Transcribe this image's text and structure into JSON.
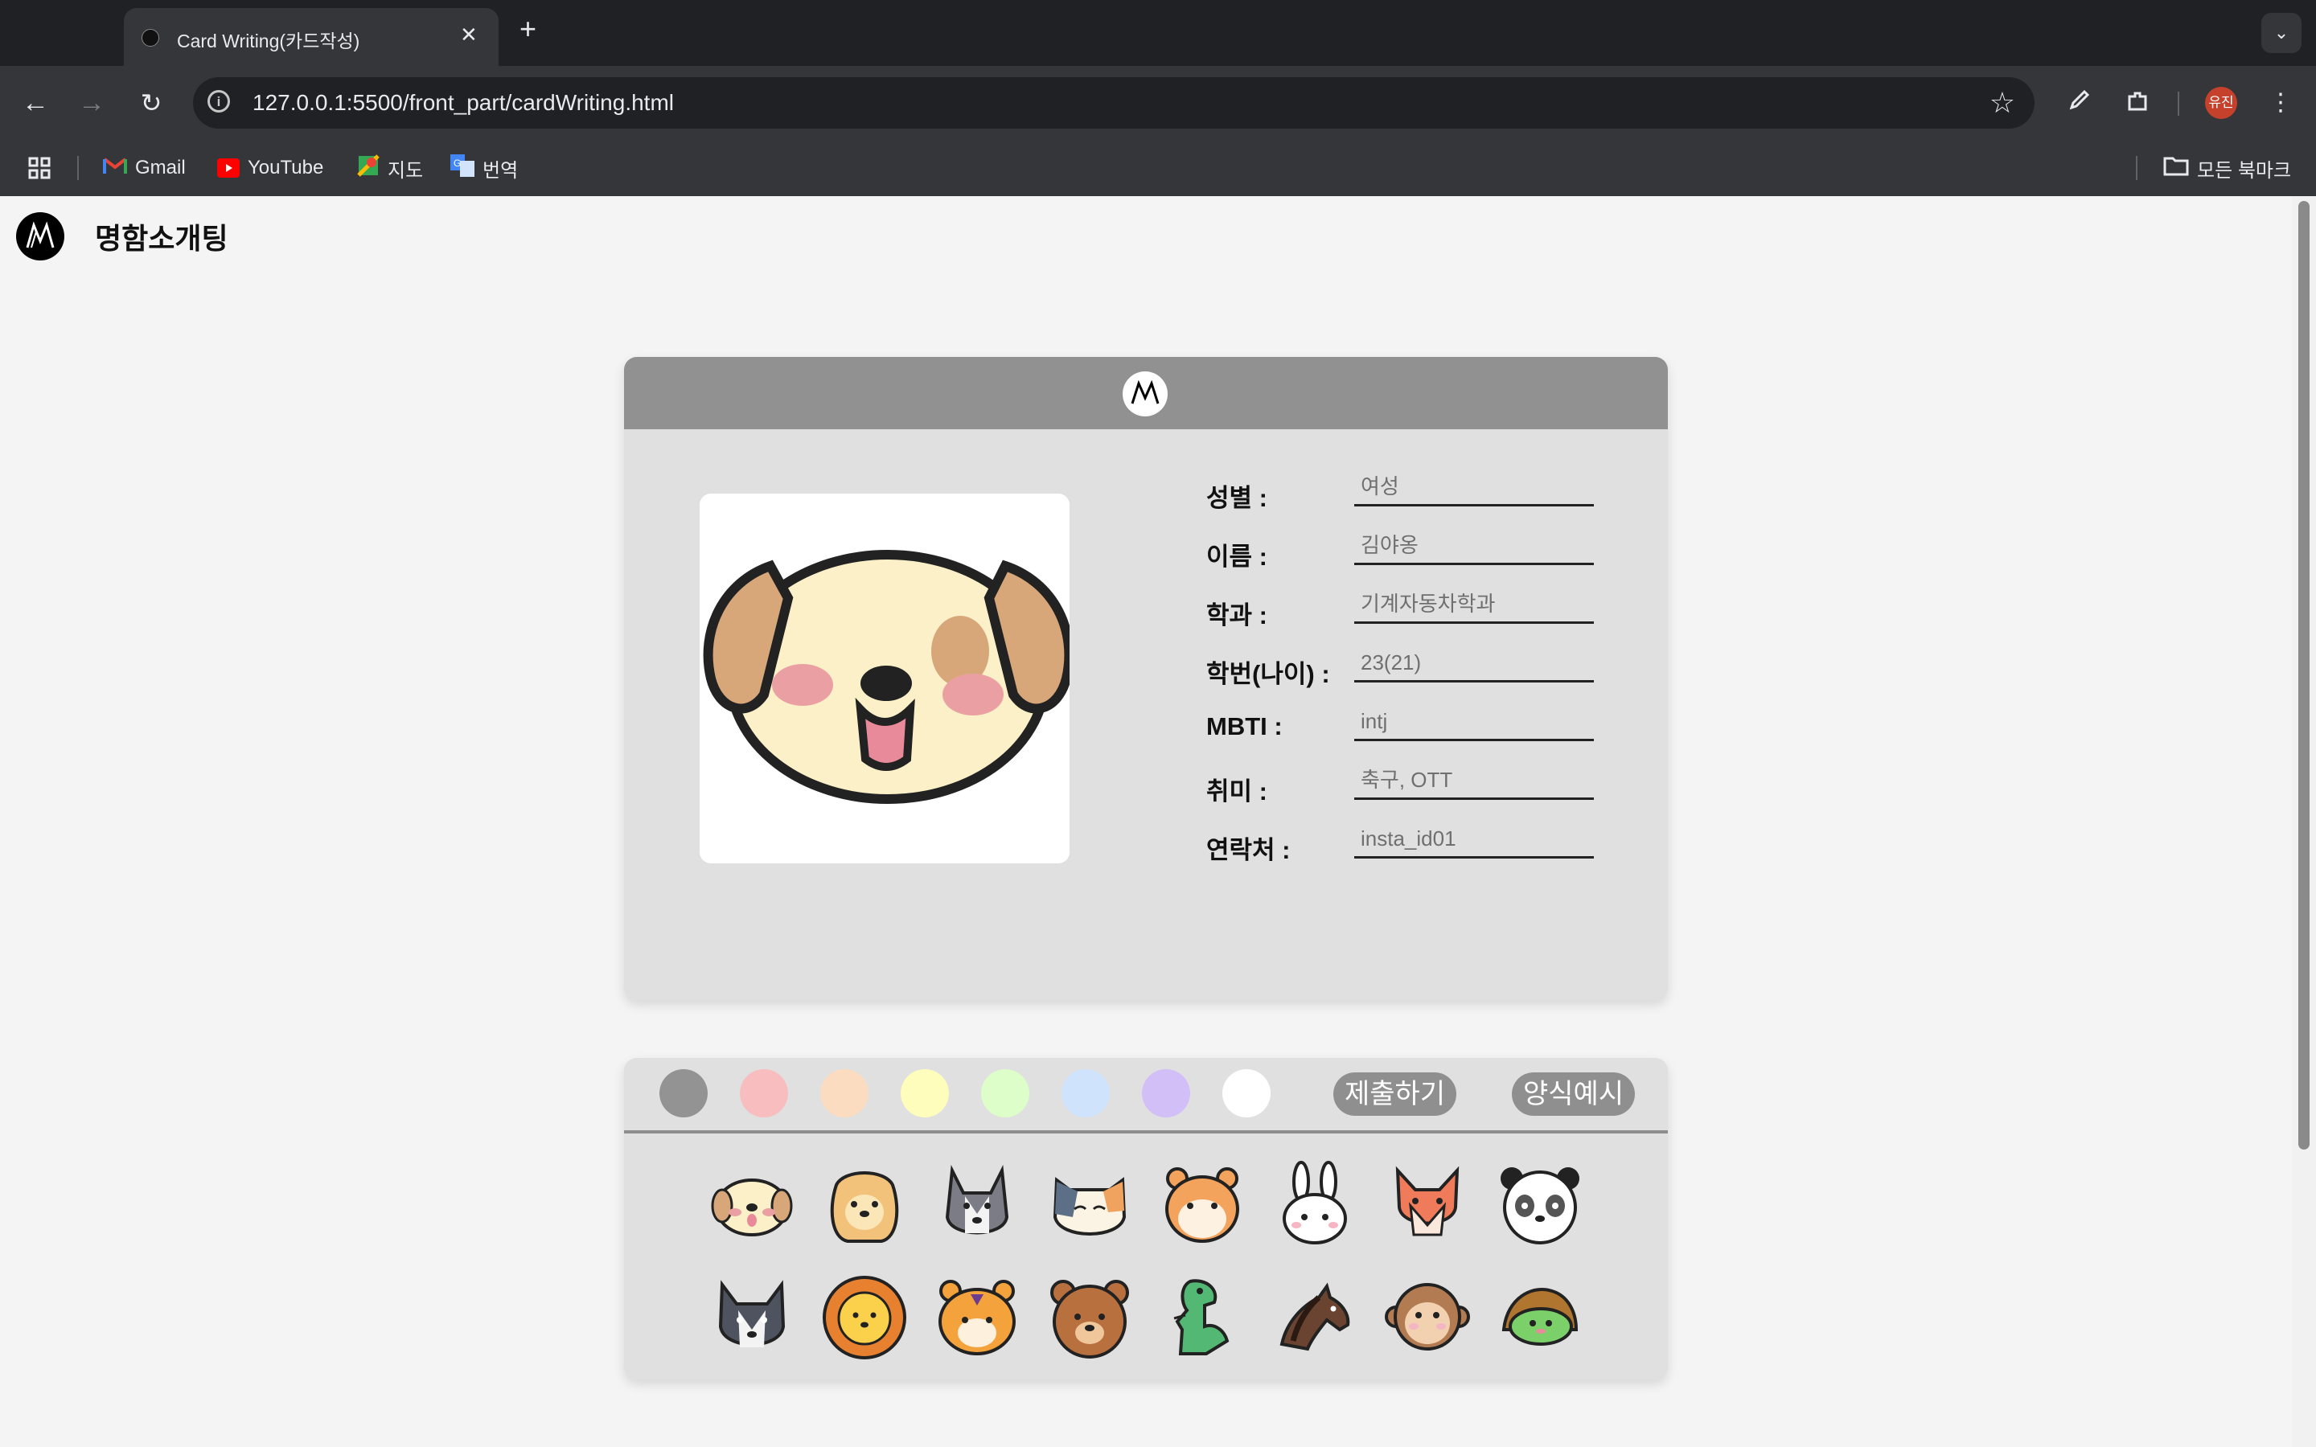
{
  "browser": {
    "tab_title": "Card Writing(카드작성)",
    "tab_close": "✕",
    "new_tab": "+",
    "url": "127.0.0.1:5500/front_part/cardWriting.html",
    "profile_label": "유진",
    "bookmarks": [
      "Gmail",
      "YouTube",
      "지도",
      "번역"
    ],
    "all_bookmarks": "모든 북마크"
  },
  "site": {
    "name": "명함소개팅"
  },
  "form": {
    "fields": [
      {
        "label": "성별 :",
        "placeholder": "여성"
      },
      {
        "label": "이름 :",
        "placeholder": "김야옹"
      },
      {
        "label": "학과 :",
        "placeholder": "기계자동차학과"
      },
      {
        "label": "학번(나이) :",
        "placeholder": "23(21)"
      },
      {
        "label": "MBTI :",
        "placeholder": "intj"
      },
      {
        "label": "취미 :",
        "placeholder": "축구, OTT"
      },
      {
        "label": "연락처 :",
        "placeholder": "insta_id01"
      }
    ]
  },
  "palette": {
    "colors": [
      "#939393",
      "#f8bdbf",
      "#fbdcc1",
      "#fefdbb",
      "#ddfdc9",
      "#cfe3fd",
      "#d3bff7",
      "#ffffff"
    ],
    "submit_label": "제출하기",
    "example_label": "양식예시"
  },
  "icons": {
    "back": "back-arrow-icon",
    "forward": "forward-arrow-icon",
    "reload": "reload-icon",
    "info": "site-info-icon",
    "star": "bookmark-star-icon",
    "eyedropper": "eyedropper-icon",
    "extensions": "extensions-icon",
    "menu": "kebab-menu-icon",
    "apps": "apps-grid-icon",
    "folder": "folder-icon",
    "animals": [
      "puppy-icon",
      "golden-retriever-icon",
      "husky-icon",
      "calico-cat-icon",
      "hamster-icon",
      "rabbit-icon",
      "fox-icon",
      "panda-icon",
      "wolf-icon",
      "lion-icon",
      "tiger-icon",
      "bear-icon",
      "dinosaur-icon",
      "horse-icon",
      "monkey-icon",
      "turtle-icon"
    ]
  }
}
